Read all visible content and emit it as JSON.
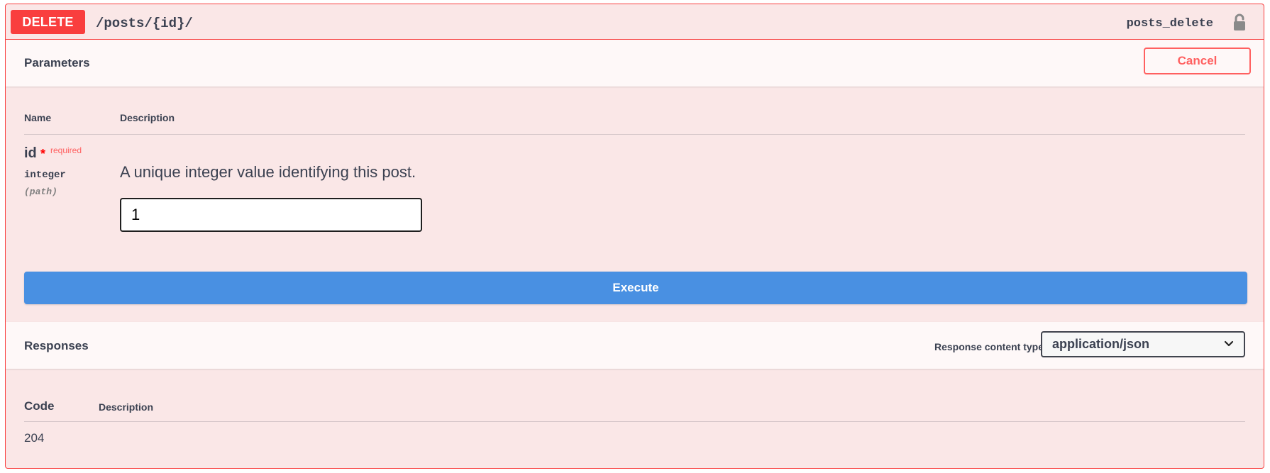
{
  "operation": {
    "method": "DELETE",
    "path": "/posts/{id}/",
    "operation_id": "posts_delete"
  },
  "parameters": {
    "title": "Parameters",
    "cancel_label": "Cancel",
    "col_name": "Name",
    "col_description": "Description",
    "items": [
      {
        "name": "id",
        "required_star": "*",
        "required_label": "required",
        "type": "integer",
        "in": "(path)",
        "description": "A unique integer value identifying this post.",
        "value": "1"
      }
    ]
  },
  "execute_label": "Execute",
  "responses": {
    "title": "Responses",
    "content_type_label": "Response content type",
    "content_type_value": "application/json",
    "col_code": "Code",
    "col_description": "Description",
    "rows": [
      {
        "code": "204"
      }
    ]
  },
  "colors": {
    "method_bg": "#f93e3e",
    "block_bg": "#fae7e7",
    "execute_bg": "#4990e2",
    "cancel": "#ff6060"
  }
}
